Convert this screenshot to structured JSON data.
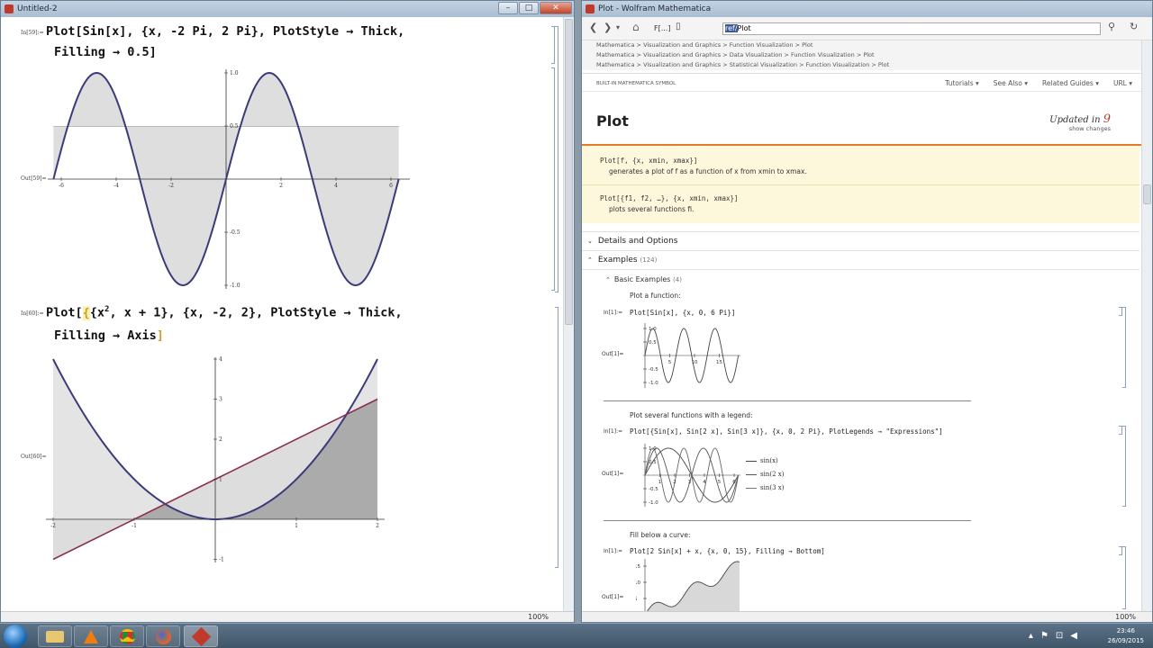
{
  "notebook": {
    "title": "Untitled-2",
    "cell1": {
      "in_label": "In[59]:=",
      "line1": "Plot[Sin[x], {x, -2 Pi, 2 Pi}, PlotStyle → Thick,",
      "line2": "Filling → 0.5]",
      "out_label": "Out[59]=",
      "xticks": [
        "-6",
        "-4",
        "-2",
        "2",
        "4",
        "6"
      ],
      "yticks": [
        "1.0",
        "0.5",
        "-0.5",
        "-1.0"
      ]
    },
    "cell2": {
      "in_label": "In[60]:=",
      "line1_a": "Plot[",
      "line1_b": "{x",
      "line1_sup": "2",
      "line1_c": ", x + 1}, {x, -2, 2}, PlotStyle → Thick,",
      "line2": "Filling → Axis",
      "line2_bracket": "]",
      "out_label": "Out[60]=",
      "xticks": [
        "-2",
        "-1",
        "1",
        "2"
      ],
      "yticks": [
        "4",
        "3",
        "2",
        "1",
        "-1"
      ]
    },
    "zoom": "100%"
  },
  "doc": {
    "title": "Plot - Wolfram Mathematica",
    "search_value": "Plot",
    "search_prefix": "ref/",
    "nav_box": "F[...]",
    "breadcrumbs": [
      "Mathematica > Visualization and Graphics > Function Visualization > Plot",
      "Mathematica > Visualization and Graphics > Data Visualization > Function Visualization > Plot",
      "Mathematica > Visualization and Graphics > Statistical Visualization > Function Visualization > Plot"
    ],
    "symbol_kind": "BUILT-IN MATHEMATICA SYMBOL",
    "menus": [
      "Tutorials ▾",
      "See Also ▾",
      "Related Guides ▾",
      "URL ▾"
    ],
    "heading": "Plot",
    "updated_label": "Updated in",
    "updated_version": "9",
    "show_changes": "show changes",
    "usage1_code": "Plot[f, {x, xmin, xmax}]",
    "usage1_desc": "generates a plot of f as a function of x from xmin to xmax.",
    "usage2_code": "Plot[{f1, f2, …}, {x, xmin, xmax}]",
    "usage2_desc": "plots several functions fi.",
    "details": "Details and Options",
    "examples": "Examples",
    "examples_count": "(124)",
    "basic": "Basic Examples",
    "basic_count": "(4)",
    "ex1_text": "Plot a function:",
    "ex1_in": "In[1]:=",
    "ex1_code": "Plot[Sin[x], {x, 0, 6 Pi}]",
    "ex1_out": "Out[1]=",
    "ex1_xticks": [
      "5",
      "10",
      "15"
    ],
    "ex1_yticks": [
      "1.0",
      "0.5",
      "-0.5",
      "-1.0"
    ],
    "ex2_text": "Plot several functions with a legend:",
    "ex2_in": "In[1]:=",
    "ex2_code": "Plot[{Sin[x], Sin[2 x], Sin[3 x]}, {x, 0, 2 Pi}, PlotLegends → \"Expressions\"]",
    "ex2_out": "Out[1]=",
    "ex2_legend": [
      "sin(x)",
      "sin(2 x)",
      "sin(3 x)"
    ],
    "ex2_xticks": [
      "1",
      "2",
      "3",
      "4",
      "5",
      "6"
    ],
    "ex2_yticks": [
      "1.0",
      "0.5",
      "-0.5",
      "-1.0"
    ],
    "ex3_text": "Fill below a curve:",
    "ex3_in": "In[1]:=",
    "ex3_code": "Plot[2 Sin[x] + x, {x, 0, 15}, Filling → Bottom]",
    "ex3_out": "Out[1]=",
    "ex3_yticks": [
      "15",
      "10",
      "5"
    ],
    "zoom": "100%"
  },
  "taskbar": {
    "time": "23:46",
    "date": "26/09/2015"
  }
}
